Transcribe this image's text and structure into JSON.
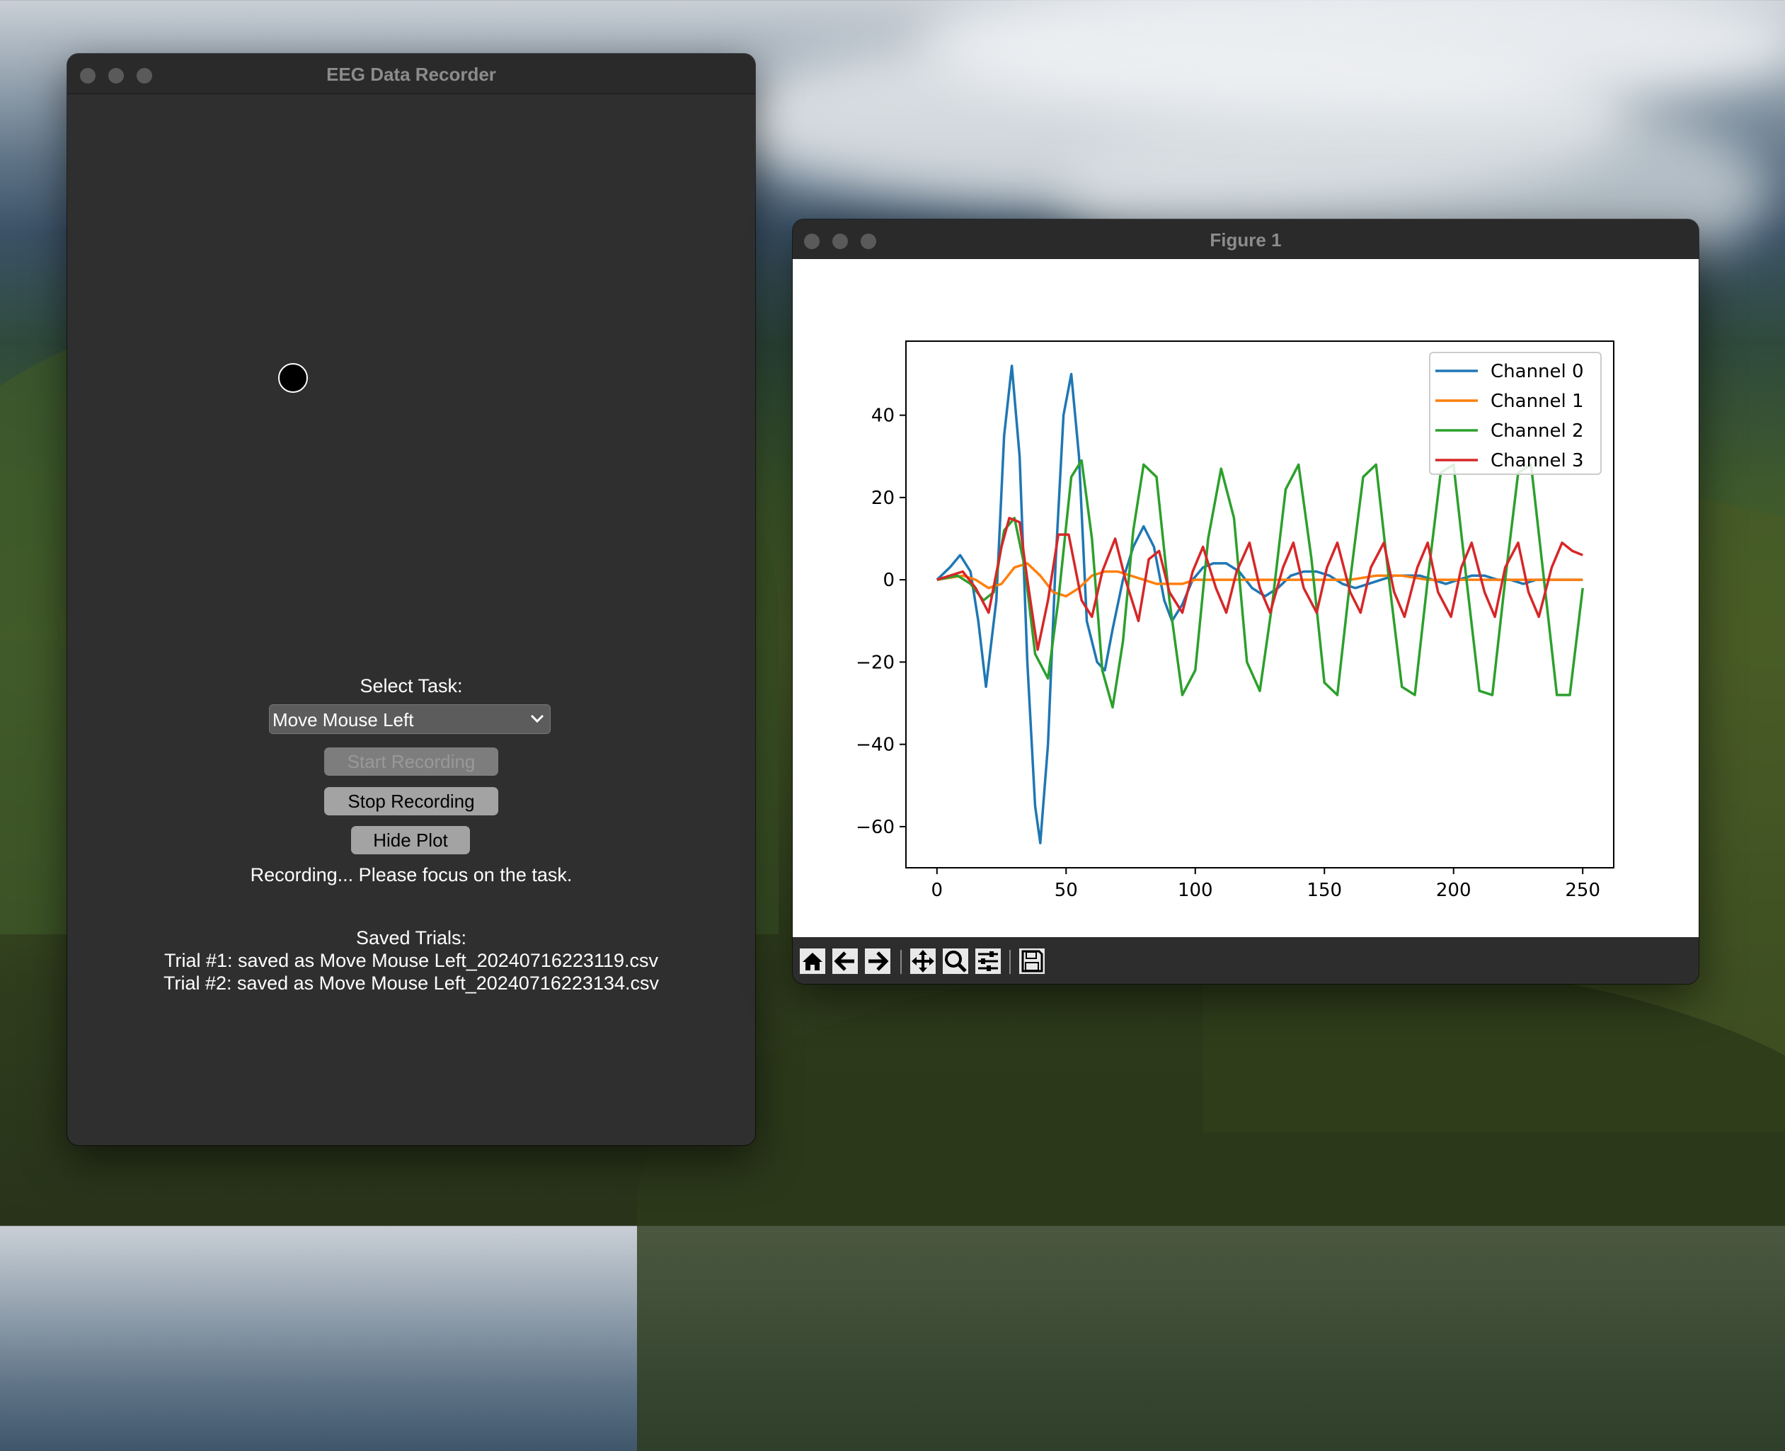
{
  "recorder": {
    "title": "EEG Data Recorder",
    "select_label": "Select Task:",
    "task_selected": "Move Mouse Left",
    "start_button": "Start Recording",
    "stop_button": "Stop Recording",
    "hide_plot_button": "Hide Plot",
    "status": "Recording... Please focus on the task.",
    "saved_header": "Saved Trials:",
    "trials": [
      "Trial #1: saved as Move Mouse Left_20240716223119.csv",
      "Trial #2: saved as Move Mouse Left_20240716223134.csv"
    ]
  },
  "figure": {
    "title": "Figure 1",
    "toolbar": [
      "home-icon",
      "back-arrow-icon",
      "forward-arrow-icon",
      "pan-icon",
      "zoom-icon",
      "configure-subplots-icon",
      "save-icon"
    ]
  },
  "chart_data": {
    "type": "line",
    "xlim": [
      -12,
      262
    ],
    "ylim": [
      -70,
      58
    ],
    "xticks": [
      0,
      50,
      100,
      150,
      200,
      250
    ],
    "xtick_labels": [
      "0",
      "50",
      "100",
      "150",
      "200",
      "250"
    ],
    "yticks": [
      -60,
      -40,
      -20,
      0,
      20,
      40
    ],
    "ytick_labels": [
      "−60",
      "−40",
      "−20",
      "0",
      "20",
      "40"
    ],
    "legend_position": "upper-right",
    "grid": false,
    "series": [
      {
        "name": "Channel 0",
        "color": "#1f77b4",
        "x": [
          0,
          5,
          9,
          13,
          16,
          19,
          23,
          26,
          29,
          32,
          35,
          38,
          40,
          43,
          46,
          49,
          52,
          55,
          58,
          62,
          65,
          68,
          72,
          76,
          80,
          84,
          88,
          91,
          95,
          99,
          103,
          107,
          112,
          117,
          122,
          127,
          132,
          137,
          142,
          147,
          152,
          157,
          162,
          167,
          172,
          177,
          182,
          187,
          192,
          197,
          202,
          207,
          212,
          217,
          222,
          227,
          232,
          237,
          242,
          247,
          250
        ],
        "y": [
          0,
          3,
          6,
          2,
          -10,
          -26,
          -5,
          35,
          52,
          30,
          -20,
          -55,
          -64,
          -40,
          5,
          40,
          50,
          30,
          -10,
          -20,
          -22,
          -12,
          0,
          8,
          13,
          8,
          -5,
          -10,
          -6,
          0,
          3,
          4,
          4,
          2,
          -2,
          -4,
          -2,
          1,
          2,
          2,
          1,
          -1,
          -2,
          -1,
          0,
          1,
          1,
          1,
          0,
          -1,
          0,
          1,
          1,
          0,
          0,
          -1,
          0,
          0,
          0,
          0,
          0
        ]
      },
      {
        "name": "Channel 1",
        "color": "#ff7f0e",
        "x": [
          0,
          10,
          15,
          20,
          25,
          30,
          35,
          40,
          45,
          50,
          55,
          60,
          65,
          70,
          75,
          80,
          85,
          90,
          95,
          100,
          110,
          120,
          130,
          140,
          150,
          160,
          170,
          180,
          190,
          200,
          210,
          220,
          230,
          240,
          250
        ],
        "y": [
          0,
          1,
          0,
          -2,
          -1,
          3,
          4,
          1,
          -3,
          -4,
          -2,
          1,
          2,
          2,
          1,
          0,
          -1,
          -1,
          -1,
          0,
          0,
          0,
          0,
          0,
          0,
          0,
          1,
          1,
          0,
          0,
          0,
          0,
          0,
          0,
          0
        ]
      },
      {
        "name": "Channel 2",
        "color": "#2ca02c",
        "x": [
          0,
          8,
          13,
          18,
          22,
          26,
          30,
          34,
          38,
          43,
          47,
          52,
          56,
          60,
          64,
          68,
          72,
          76,
          80,
          85,
          90,
          95,
          100,
          105,
          110,
          115,
          120,
          125,
          130,
          135,
          140,
          145,
          150,
          155,
          160,
          165,
          170,
          175,
          180,
          185,
          190,
          195,
          200,
          205,
          210,
          215,
          220,
          225,
          230,
          235,
          240,
          245,
          250
        ],
        "y": [
          0,
          1,
          -1,
          -5,
          -3,
          12,
          15,
          3,
          -18,
          -24,
          -5,
          25,
          29,
          10,
          -22,
          -31,
          -15,
          12,
          28,
          25,
          -5,
          -28,
          -22,
          10,
          27,
          15,
          -20,
          -27,
          -5,
          22,
          28,
          5,
          -25,
          -28,
          0,
          25,
          28,
          0,
          -26,
          -28,
          0,
          26,
          28,
          0,
          -27,
          -28,
          0,
          26,
          28,
          0,
          -28,
          -28,
          -2
        ]
      },
      {
        "name": "Channel 3",
        "color": "#d62728",
        "x": [
          0,
          10,
          15,
          20,
          25,
          28,
          32,
          35,
          39,
          43,
          47,
          51,
          56,
          60,
          64,
          69,
          73,
          78,
          82,
          86,
          90,
          95,
          99,
          103,
          108,
          112,
          116,
          121,
          125,
          129,
          134,
          138,
          142,
          147,
          151,
          155,
          160,
          164,
          168,
          173,
          177,
          181,
          186,
          190,
          194,
          199,
          203,
          207,
          212,
          216,
          220,
          225,
          229,
          233,
          238,
          242,
          246,
          250
        ],
        "y": [
          0,
          2,
          -2,
          -8,
          8,
          15,
          14,
          0,
          -17,
          -5,
          11,
          11,
          -5,
          -9,
          2,
          10,
          0,
          -10,
          5,
          7,
          -3,
          -8,
          2,
          8,
          -2,
          -8,
          2,
          9,
          -2,
          -8,
          3,
          9,
          -2,
          -8,
          3,
          9,
          -3,
          -8,
          3,
          9,
          -3,
          -9,
          3,
          9,
          -3,
          -9,
          3,
          9,
          -3,
          -9,
          3,
          9,
          -3,
          -9,
          3,
          9,
          7,
          6
        ]
      }
    ]
  }
}
